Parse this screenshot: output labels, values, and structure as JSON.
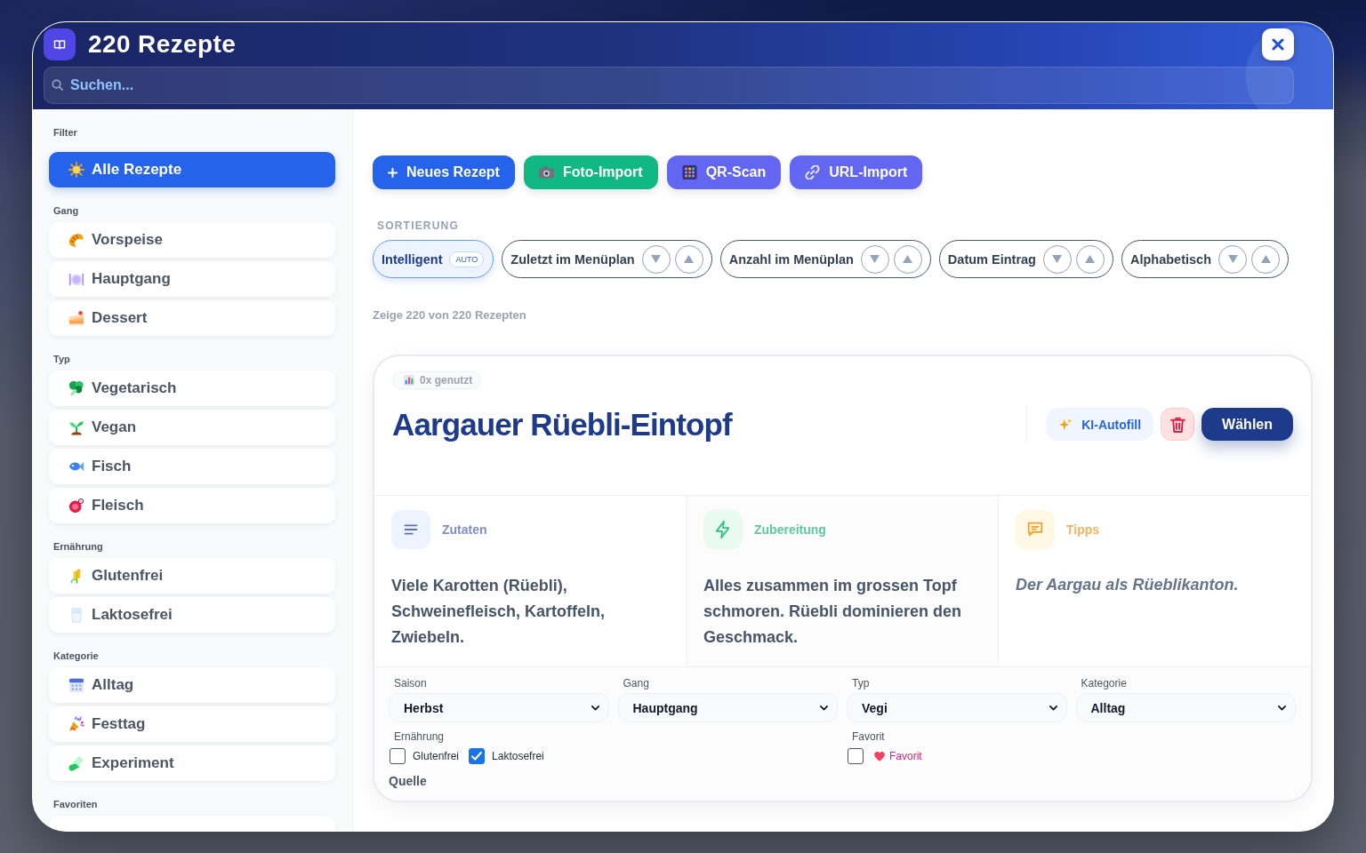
{
  "header": {
    "title": "220 Rezepte",
    "search": {
      "placeholder": "Suchen..."
    }
  },
  "sidebar": {
    "sections": [
      {
        "label": "Filter",
        "items": [
          {
            "label": "Alle Rezepte",
            "selected": true
          }
        ]
      },
      {
        "label": "Gang",
        "items": [
          {
            "label": "Vorspeise",
            "selected": false
          },
          {
            "label": "Hauptgang",
            "selected": false
          },
          {
            "label": "Dessert",
            "selected": false
          }
        ]
      },
      {
        "label": "Typ",
        "items": [
          {
            "label": "Vegetarisch",
            "selected": false
          },
          {
            "label": "Vegan",
            "selected": false
          },
          {
            "label": "Fisch",
            "selected": false
          },
          {
            "label": "Fleisch",
            "selected": false
          }
        ]
      },
      {
        "label": "Ernährung",
        "items": [
          {
            "label": "Glutenfrei",
            "selected": false
          },
          {
            "label": "Laktosefrei",
            "selected": false
          }
        ]
      },
      {
        "label": "Kategorie",
        "items": [
          {
            "label": "Alltag",
            "selected": false
          },
          {
            "label": "Festtag",
            "selected": false
          },
          {
            "label": "Experiment",
            "selected": false
          }
        ]
      },
      {
        "label": "Favoriten",
        "items": [
          {
            "selected": false
          }
        ]
      }
    ]
  },
  "toolbar": {
    "actions": [
      {
        "label": "Neues Rezept",
        "color": "#2563eb"
      },
      {
        "label": "Foto-Import",
        "color": "#10b981"
      },
      {
        "label": "QR-Scan",
        "color": "#6366f1"
      },
      {
        "label": "URL-Import",
        "color": "#6366f1"
      }
    ]
  },
  "sorting": {
    "label": "SORTIERUNG",
    "options": [
      {
        "kind": "auto",
        "label": "Intelligent",
        "badge": "AUTO",
        "selected": true
      },
      {
        "kind": "directional",
        "label": "Zuletzt im Menüplan",
        "selected": false
      },
      {
        "kind": "directional",
        "label": "Anzahl im Menüplan",
        "selected": false
      },
      {
        "kind": "directional",
        "label": "Datum Eintrag",
        "selected": false
      },
      {
        "kind": "directional",
        "label": "Alphabetisch",
        "selected": false
      }
    ]
  },
  "count_text": "Zeige 220 von 220 Rezepten",
  "card": {
    "usage": "0x genutzt",
    "title": "Aargauer Rüebli-Eintopf",
    "autofill_label": "KI-Autofill",
    "choose_label": "Wählen",
    "sections": [
      {
        "kind": "ingredients",
        "title": "Zutaten",
        "color": "#7f8fc8",
        "text": "Viele Karotten (Rüebli), Schweinefleisch, Kartoffeln, Zwiebeln."
      },
      {
        "kind": "preparation",
        "title": "Zubereitung",
        "color": "#5ec9a0",
        "text": "Alles zusammen im grossen Topf schmoren. Rüebli dominieren den Geschmack."
      },
      {
        "kind": "tips",
        "title": "Tipps",
        "color": "#f2b35e",
        "text": "Der Aargau als Rüeblikanton."
      }
    ],
    "fields": [
      {
        "label": "Saison",
        "value": "Herbst"
      },
      {
        "label": "Gang",
        "value": "Hauptgang"
      },
      {
        "label": "Typ",
        "value": "Vegi"
      },
      {
        "label": "Kategorie",
        "value": "Alltag"
      }
    ],
    "diet": {
      "label": "Ernährung",
      "options": [
        {
          "label": "Glutenfrei",
          "checked": false
        },
        {
          "label": "Laktosefrei",
          "checked": true
        }
      ]
    },
    "favorite": {
      "label": "Favorit",
      "option": "Favorit",
      "checked": false
    },
    "source_label": "Quelle"
  }
}
